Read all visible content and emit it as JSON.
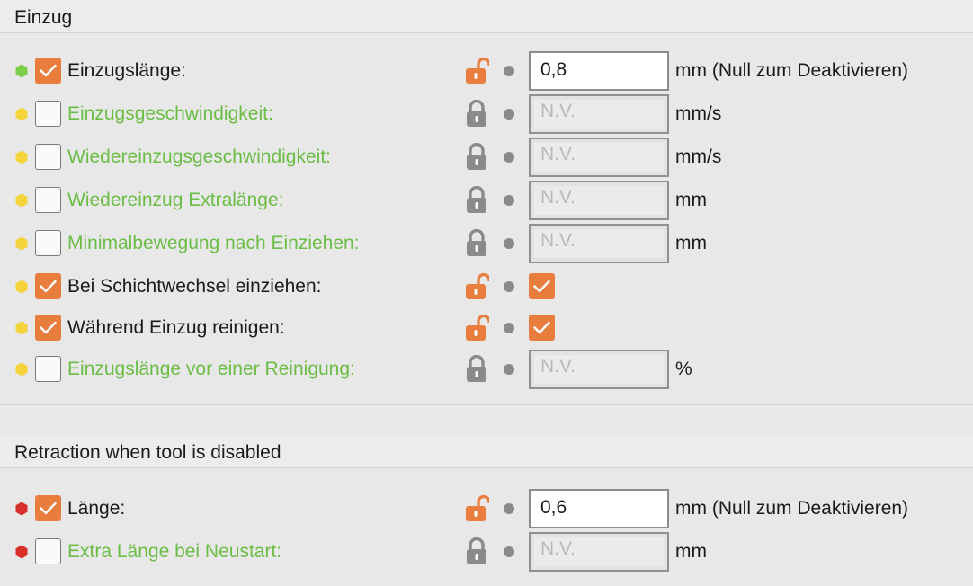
{
  "colors": {
    "accent": "#e87d3e",
    "system_value_label": "#6bbd45",
    "mode_simple": "#7ccf4a",
    "mode_advanced": "#f5d33a",
    "mode_expert": "#d7302a",
    "lock_gray": "#8a8a8a"
  },
  "groups": [
    {
      "title": "Einzug",
      "rows": [
        {
          "mode": "simple",
          "checked": true,
          "label": "Einzugslänge:",
          "system": false,
          "lock": "unlocked-orange",
          "value": "0,8",
          "unit": "mm (Null zum Deaktivieren)"
        },
        {
          "mode": "advanced",
          "checked": false,
          "label": "Einzugsgeschwindigkeit:",
          "system": true,
          "lock": "locked-gray",
          "value": "N.V.",
          "unit": "mm/s"
        },
        {
          "mode": "advanced",
          "checked": false,
          "label": "Wiedereinzugsgeschwindigkeit:",
          "system": true,
          "lock": "locked-gray",
          "value": "N.V.",
          "unit": "mm/s"
        },
        {
          "mode": "advanced",
          "checked": false,
          "label": "Wiedereinzug Extralänge:",
          "system": true,
          "lock": "locked-gray",
          "value": "N.V.",
          "unit": "mm"
        },
        {
          "mode": "advanced",
          "checked": false,
          "label": "Minimalbewegung nach Einziehen:",
          "system": true,
          "lock": "locked-gray",
          "value": "N.V.",
          "unit": "mm"
        },
        {
          "mode": "advanced",
          "checked": true,
          "label": "Bei Schichtwechsel einziehen:",
          "system": false,
          "lock": "unlocked-orange",
          "value_checkbox": true
        },
        {
          "mode": "advanced",
          "checked": true,
          "label": "Während Einzug reinigen:",
          "system": false,
          "lock": "unlocked-orange",
          "value_checkbox": true
        },
        {
          "mode": "advanced",
          "checked": false,
          "label": "Einzugslänge vor einer Reinigung:",
          "system": true,
          "lock": "locked-gray",
          "value": "N.V.",
          "unit": "%"
        }
      ]
    },
    {
      "title": "Retraction when tool is disabled",
      "rows": [
        {
          "mode": "expert",
          "checked": true,
          "label": "Länge:",
          "system": false,
          "lock": "unlocked-orange",
          "value": "0,6",
          "unit": "mm (Null zum Deaktivieren)"
        },
        {
          "mode": "expert",
          "checked": false,
          "label": "Extra Länge bei Neustart:",
          "system": true,
          "lock": "locked-gray",
          "value": "N.V.",
          "unit": "mm"
        }
      ]
    }
  ]
}
